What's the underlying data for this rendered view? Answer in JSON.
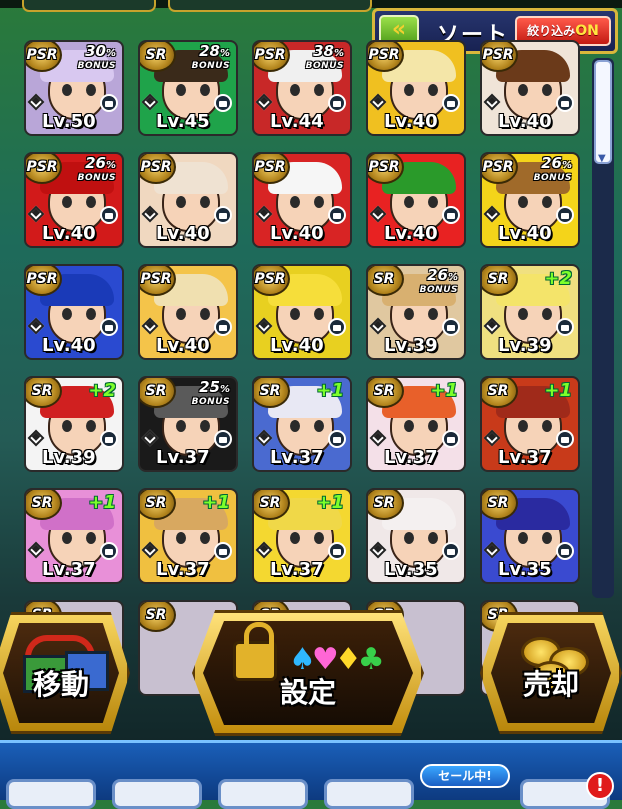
{
  "header": {
    "sort_label": "ソート",
    "filter_label": "絞り込み",
    "filter_state": "ON",
    "toggle_icon": "double-chevron-left-icon"
  },
  "cards": [
    {
      "rarity": "PSR",
      "bonus": "30",
      "bonus_label": "BONUS",
      "level": "Lv.50",
      "bg": "#b9a6d8",
      "hair": "#d8c8f0"
    },
    {
      "rarity": "SR",
      "bonus": "28",
      "bonus_label": "BONUS",
      "level": "Lv.45",
      "bg": "#1fa34a",
      "hair": "#3a2a1a"
    },
    {
      "rarity": "PSR",
      "bonus": "38",
      "bonus_label": "BONUS",
      "level": "Lv.44",
      "bg": "#c82828",
      "hair": "#f0f0f0"
    },
    {
      "rarity": "PSR",
      "bonus": "",
      "bonus_label": "",
      "level": "Lv.40",
      "bg": "#f0c020",
      "hair": "#f4e6a8"
    },
    {
      "rarity": "PSR",
      "bonus": "",
      "bonus_label": "",
      "level": "Lv.40",
      "bg": "#f0e4d8",
      "hair": "#6b3a1a"
    },
    {
      "rarity": "PSR",
      "bonus": "26",
      "bonus_label": "BONUS",
      "level": "Lv.40",
      "bg": "#d21a1a",
      "hair": "#c01010"
    },
    {
      "rarity": "PSR",
      "bonus": "",
      "bonus_label": "",
      "level": "Lv.40",
      "bg": "#f0d8c0",
      "hair": "#efe2d2"
    },
    {
      "rarity": "PSR",
      "bonus": "",
      "bonus_label": "",
      "level": "Lv.40",
      "bg": "#d82424",
      "hair": "#f6f6f6"
    },
    {
      "rarity": "PSR",
      "bonus": "",
      "bonus_label": "",
      "level": "Lv.40",
      "bg": "#e82222",
      "hair": "#2a9a2a"
    },
    {
      "rarity": "PSR",
      "bonus": "26",
      "bonus_label": "BONUS",
      "level": "Lv.40",
      "bg": "#f4d41a",
      "hair": "#a06a2a"
    },
    {
      "rarity": "PSR",
      "bonus": "",
      "bonus_label": "",
      "level": "Lv.40",
      "bg": "#2a4ad0",
      "hair": "#1a3ab8"
    },
    {
      "rarity": "PSR",
      "bonus": "",
      "bonus_label": "",
      "level": "Lv.40",
      "bg": "#f4c44a",
      "hair": "#f0e0b0"
    },
    {
      "rarity": "PSR",
      "bonus": "",
      "bonus_label": "",
      "level": "Lv.40",
      "bg": "#e8d020",
      "hair": "#f6de3a"
    },
    {
      "rarity": "SR",
      "bonus": "26",
      "bonus_label": "BONUS",
      "level": "Lv.39",
      "bg": "#e0c8a0",
      "hair": "#d8b070"
    },
    {
      "rarity": "SR",
      "bonus": "",
      "bonus_label": "",
      "level": "Lv.39",
      "bg": "#f0e080",
      "hair": "#f4e46a",
      "plus": "+2"
    },
    {
      "rarity": "SR",
      "bonus": "",
      "bonus_label": "",
      "level": "Lv.39",
      "bg": "#f4f4f4",
      "hair": "#d02020",
      "plus": "+2"
    },
    {
      "rarity": "SR",
      "bonus": "25",
      "bonus_label": "BONUS",
      "level": "Lv.37",
      "bg": "#1a1a1a",
      "hair": "#5a5a5a"
    },
    {
      "rarity": "SR",
      "bonus": "",
      "bonus_label": "",
      "level": "Lv.37",
      "bg": "#4a6ad0",
      "hair": "#e8e8f4",
      "plus": "+1"
    },
    {
      "rarity": "SR",
      "bonus": "",
      "bonus_label": "",
      "level": "Lv.37",
      "bg": "#f4e0e8",
      "hair": "#e8602a",
      "plus": "+1"
    },
    {
      "rarity": "SR",
      "bonus": "",
      "bonus_label": "",
      "level": "Lv.37",
      "bg": "#c83a1a",
      "hair": "#a02a1a",
      "plus": "+1"
    },
    {
      "rarity": "SR",
      "bonus": "",
      "bonus_label": "",
      "level": "Lv.37",
      "bg": "#e890d8",
      "hair": "#d070c8",
      "plus": "+1"
    },
    {
      "rarity": "SR",
      "bonus": "",
      "bonus_label": "",
      "level": "Lv.37",
      "bg": "#f0c040",
      "hair": "#d8a860",
      "plus": "+1"
    },
    {
      "rarity": "SR",
      "bonus": "",
      "bonus_label": "",
      "level": "Lv.37",
      "bg": "#f4d830",
      "hair": "#f0d848",
      "plus": "+1"
    },
    {
      "rarity": "SR",
      "bonus": "",
      "bonus_label": "",
      "level": "Lv.35",
      "bg": "#f0e8e8",
      "hair": "#f4f0f0"
    },
    {
      "rarity": "SR",
      "bonus": "",
      "bonus_label": "",
      "level": "Lv.35",
      "bg": "#3a4ad0",
      "hair": "#2a2aa0"
    }
  ],
  "actions": {
    "move_label": "移動",
    "settings_label": "設定",
    "sell_label": "売却"
  },
  "partial_row": [
    {
      "rarity": "SR"
    },
    {
      "rarity": "SR"
    },
    {
      "rarity": "SR"
    },
    {
      "rarity": "SR"
    },
    {
      "rarity": "SR"
    }
  ],
  "tabbar": {
    "sale_label": "セール中!",
    "alert": "!"
  }
}
